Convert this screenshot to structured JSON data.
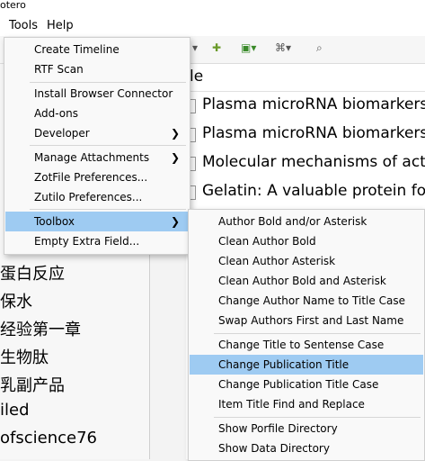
{
  "window": {
    "title": "otero"
  },
  "menubar": {
    "tools": "Tools",
    "help": "Help"
  },
  "collections": [
    "蛋白反应",
    "保水",
    "经验第一章",
    "生物肽",
    "乳副产品",
    "iled",
    "ofscience76"
  ],
  "main": {
    "column_header": "le",
    "items": [
      "Plasma microRNA biomarkers",
      "Plasma microRNA biomarkers",
      "Molecular mechanisms of act",
      "Gelatin: A valuable protein fo"
    ]
  },
  "tools_menu": {
    "items": [
      "Create Timeline",
      "RTF Scan",
      "Install Browser Connector",
      "Add-ons",
      "Developer",
      "Manage Attachments",
      "ZotFile Preferences...",
      "Zutilo Preferences...",
      "Toolbox",
      "Empty Extra Field..."
    ],
    "submenu_arrow": "❯"
  },
  "toolbox_submenu": {
    "items": [
      "Author Bold and/or Asterisk",
      "Clean Author Bold",
      "Clean Author Asterisk",
      "Clean Author Bold and Asterisk",
      "Change Author Name to Title Case",
      "Swap Authors First and Last Name",
      "Change Title to Sentense Case",
      "Change Publication Title",
      "Change Publication Title Case",
      "Item Title Find and Replace",
      "Show Porfile Directory",
      "Show Data Directory"
    ],
    "highlighted": "Change Publication Title"
  },
  "colors": {
    "highlight": "#9ecbf2",
    "menu_bg": "#f9f9f9"
  }
}
